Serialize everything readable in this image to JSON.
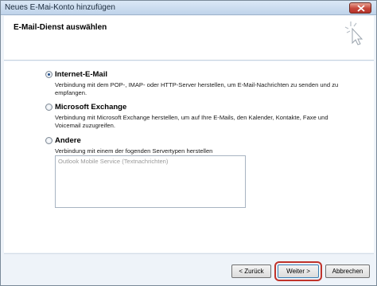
{
  "window": {
    "title": "Neues E-Mai-Konto hinzufügen"
  },
  "header": {
    "title": "E-Mail-Dienst auswählen",
    "icon": "sparkle-cursor-icon"
  },
  "options": [
    {
      "label": "Internet-E-Mail",
      "description": "Verbindung mit dem POP-, IMAP- oder HTTP-Server herstellen, um E-Mail-Nachrichten zu senden und zu empfangen.",
      "selected": true
    },
    {
      "label": "Microsoft Exchange",
      "description": "Verbindung mit Microsoft Exchange herstellen, um auf Ihre E-Mails, den Kalender, Kontakte, Faxe und Voicemail zuzugreifen.",
      "selected": false
    },
    {
      "label": "Andere",
      "description": "Verbindung mit einem der fogenden Servertypen herstellen",
      "selected": false
    }
  ],
  "server_types": [
    "Outlook Mobile Service (Textnachrichten)"
  ],
  "buttons": {
    "back": "< Zurück",
    "next": "Weiter >",
    "cancel": "Abbrechen"
  },
  "colors": {
    "highlight_border": "#c0332b",
    "close_button": "#c6473a"
  }
}
